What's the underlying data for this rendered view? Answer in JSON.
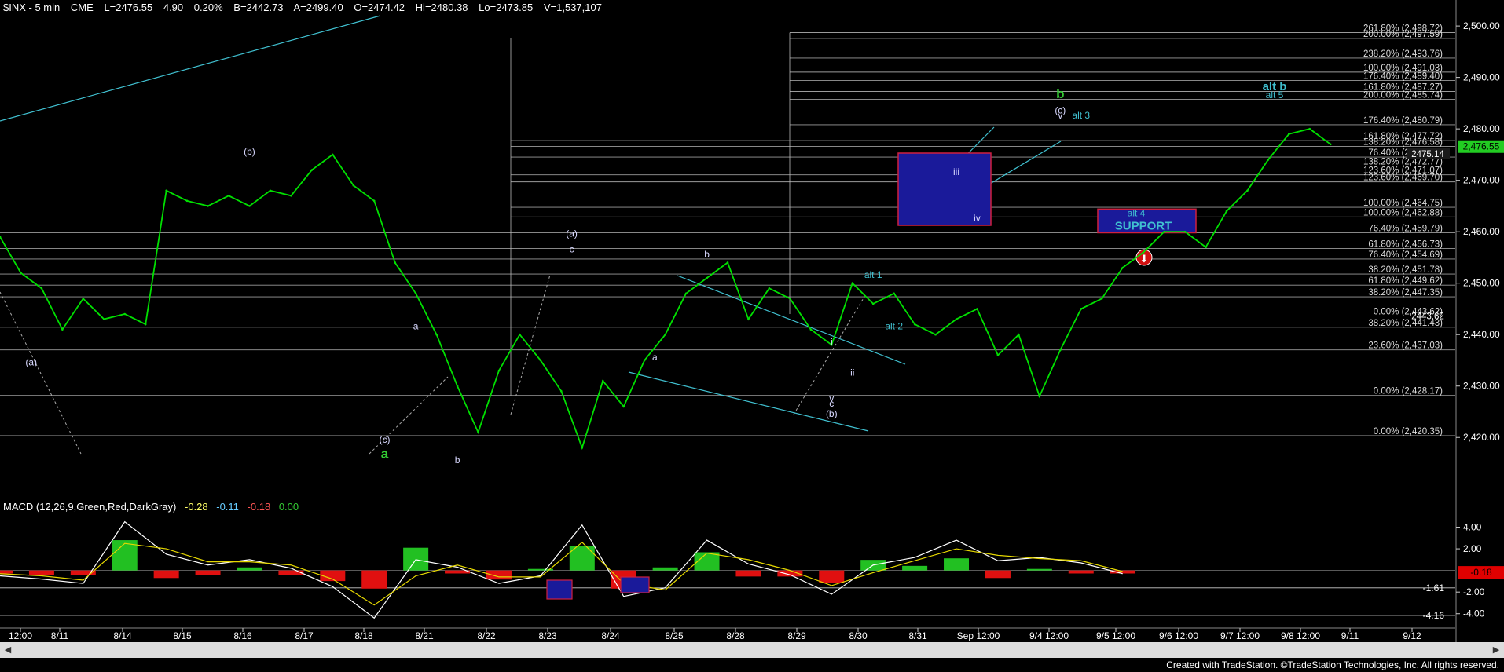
{
  "header": {
    "symbol": "$INX - 5 min",
    "exchange": "CME",
    "last": "L=2476.55",
    "change": "4.90",
    "change_pct": "0.20%",
    "bid": "B=2442.73",
    "ask": "A=2499.40",
    "open": "O=2474.42",
    "high": "Hi=2480.38",
    "low": "Lo=2473.85",
    "volume": "V=1,537,107"
  },
  "macd_header": {
    "name": "MACD (12,26,9,Green,Red,DarkGray)",
    "v1": "-0.28",
    "v2": "-0.11",
    "v3": "-0.18",
    "v4": "0.00"
  },
  "footer": "Created with TradeStation. ©TradeStation Technologies, Inc. All rights reserved.",
  "colors": {
    "background": "#000000",
    "price": "#00e000",
    "fib_line": "#cfcfcf",
    "channel": "#40c0d0",
    "label_wave": "#d8d8ff",
    "label_green": "#33cc33",
    "support_box": "#1a1a9a",
    "support_border": "#d02040",
    "last_price_tag": "#22cc22",
    "macd_tag": "#e00000"
  },
  "chart_data": {
    "type": "line",
    "title": "$INX - 5 min",
    "ylim": [
      2415,
      2502
    ],
    "price_ticks": [
      "2,500.00",
      "2,490.00",
      "2,480.00",
      "2,470.00",
      "2,460.00",
      "2,450.00",
      "2,440.00",
      "2,430.00",
      "2,420.00"
    ],
    "price_tick_values": [
      2500,
      2490,
      2480,
      2470,
      2460,
      2450,
      2440,
      2430,
      2420
    ],
    "x_labels": [
      "12:00",
      "8/11",
      "8/14",
      "8/15",
      "8/16",
      "8/17",
      "8/18",
      "8/21",
      "8/22",
      "8/23",
      "8/24",
      "8/25",
      "8/28",
      "8/29",
      "8/30",
      "8/31",
      "Sep 12:00",
      "9/4 12:00",
      "9/5 12:00",
      "9/6 12:00",
      "9/7 12:00",
      "9/8 12:00",
      "9/11",
      "9/12"
    ],
    "price_series": {
      "name": "$INX",
      "x": [
        0,
        2,
        4,
        6,
        8,
        10,
        12,
        14,
        16,
        18,
        20,
        22,
        24,
        26,
        28,
        30,
        32,
        34,
        36,
        38,
        40,
        42,
        44,
        46,
        48,
        50,
        52,
        54,
        56,
        58,
        60,
        62,
        64,
        66,
        68,
        70,
        72,
        74,
        76,
        78,
        80,
        82,
        84,
        86,
        88,
        90,
        92,
        94,
        96,
        98,
        100,
        102,
        104,
        106,
        108,
        110,
        112,
        114,
        116,
        118,
        120,
        122,
        124,
        126,
        128
      ],
      "y": [
        2459,
        2452,
        2449,
        2441,
        2447,
        2443,
        2444,
        2442,
        2468,
        2466,
        2465,
        2467,
        2465,
        2468,
        2467,
        2472,
        2475,
        2469,
        2466,
        2454,
        2448,
        2440,
        2430,
        2421,
        2433,
        2440,
        2435,
        2429,
        2418,
        2431,
        2426,
        2435,
        2440,
        2448,
        2451,
        2454,
        2443,
        2449,
        2447,
        2441,
        2438,
        2450,
        2446,
        2448,
        2442,
        2440,
        2443,
        2445,
        2436,
        2440,
        2428,
        2437,
        2445,
        2447,
        2453,
        2456,
        2460,
        2460,
        2457,
        2464,
        2468,
        2474,
        2479,
        2480,
        2477
      ]
    },
    "fib_levels": [
      {
        "label": "261.80% (2,498.72)",
        "value": 2498.72
      },
      {
        "label": "200.00% (2,497.59)",
        "value": 2497.59
      },
      {
        "label": "238.20% (2,493.76)",
        "value": 2493.76
      },
      {
        "label": "100.00% (2,491.03)",
        "value": 2491.03
      },
      {
        "label": "176.40% (2,489.40)",
        "value": 2489.4
      },
      {
        "label": "161.80% (2,487.27)",
        "value": 2487.27
      },
      {
        "label": "200.00% (2,485.74)",
        "value": 2485.74
      },
      {
        "label": "176.40% (2,480.79)",
        "value": 2480.79
      },
      {
        "label": "161.80% (2,477.72)",
        "value": 2477.72
      },
      {
        "label": "138.20% (2,476.58)",
        "value": 2476.58
      },
      {
        "label": "76.40% (2,474.51)",
        "value": 2474.51
      },
      {
        "label": "138.20% (2,472.77)",
        "value": 2472.77
      },
      {
        "label": "123.60% (2,471.07)",
        "value": 2471.07
      },
      {
        "label": "123.60% (2,469.70)",
        "value": 2469.7
      },
      {
        "label": "100.00% (2,464.75)",
        "value": 2464.75
      },
      {
        "label": "100.00% (2,462.88)",
        "value": 2462.88
      },
      {
        "label": "76.40% (2,459.79)",
        "value": 2459.79
      },
      {
        "label": "61.80% (2,456.73)",
        "value": 2456.73
      },
      {
        "label": "76.40% (2,454.69)",
        "value": 2454.69
      },
      {
        "label": "38.20% (2,451.78)",
        "value": 2451.78
      },
      {
        "label": "61.80% (2,449.62)",
        "value": 2449.62
      },
      {
        "label": "38.20% (2,447.35)",
        "value": 2447.35
      },
      {
        "label": "0.00% (2,443.62)",
        "value": 2443.62
      },
      {
        "label": "38.20% (2,441.43)",
        "value": 2441.43
      },
      {
        "label": "23.60% (2,437.03)",
        "value": 2437.03
      },
      {
        "label": "0.00% (2,428.17)",
        "value": 2428.17
      },
      {
        "label": "0.00% (2,420.35)",
        "value": 2420.35
      }
    ],
    "last_price_tag": "2,476.55",
    "inner_price_tag": "2475.14",
    "inner_price_tag2": "2443.62",
    "wave_labels": [
      {
        "text": "(b)",
        "x": 24,
        "y": 2475,
        "color": "wave"
      },
      {
        "text": "(a)",
        "x": 3,
        "y": 2434,
        "color": "wave"
      },
      {
        "text": "(c)",
        "x": 37,
        "y": 2419,
        "color": "wave"
      },
      {
        "text": "a",
        "x": 37,
        "y": 2416,
        "color": "green"
      },
      {
        "text": "a",
        "x": 40,
        "y": 2441,
        "color": "wave"
      },
      {
        "text": "b",
        "x": 44,
        "y": 2415,
        "color": "wave"
      },
      {
        "text": "(a)",
        "x": 55,
        "y": 2459,
        "color": "wave"
      },
      {
        "text": "c",
        "x": 55,
        "y": 2456,
        "color": "wave"
      },
      {
        "text": "b",
        "x": 68,
        "y": 2455,
        "color": "wave"
      },
      {
        "text": "a",
        "x": 63,
        "y": 2435,
        "color": "wave"
      },
      {
        "text": "v",
        "x": 80,
        "y": 2427,
        "color": "wave"
      },
      {
        "text": "c",
        "x": 80,
        "y": 2426,
        "color": "wave"
      },
      {
        "text": "(b)",
        "x": 80,
        "y": 2424,
        "color": "wave"
      },
      {
        "text": "i",
        "x": 80,
        "y": 2438,
        "color": "wave"
      },
      {
        "text": "ii",
        "x": 82,
        "y": 2432,
        "color": "wave"
      },
      {
        "text": "alt 1",
        "x": 84,
        "y": 2451,
        "color": "channel"
      },
      {
        "text": "alt 2",
        "x": 86,
        "y": 2441,
        "color": "channel"
      },
      {
        "text": "iii",
        "x": 92,
        "y": 2471,
        "color": "wave"
      },
      {
        "text": "iv",
        "x": 94,
        "y": 2462,
        "color": "wave"
      },
      {
        "text": "v",
        "x": 102,
        "y": 2482,
        "color": "wave"
      },
      {
        "text": "(c)",
        "x": 102,
        "y": 2483,
        "color": "wave"
      },
      {
        "text": "b",
        "x": 102,
        "y": 2486,
        "color": "green"
      },
      {
        "text": "alt 3",
        "x": 104,
        "y": 2482,
        "color": "channel"
      }
    ],
    "right_labels": [
      {
        "text": "alt b",
        "value": 2487.5
      },
      {
        "text": "alt 5",
        "value": 2486.0
      }
    ],
    "support": {
      "label": "SUPPORT",
      "alt_label": "alt 4",
      "top": 2464.4,
      "bottom": 2459.8
    },
    "macd": {
      "ylim": [
        -4.6,
        5.2
      ],
      "ticks": [
        "4.00",
        "2.00",
        "-2.00",
        "-4.00"
      ],
      "tick_values": [
        4,
        2,
        -2,
        -4
      ],
      "levels": [
        {
          "label": "-1.61",
          "value": -1.61
        },
        {
          "label": "-4.16",
          "value": -4.16
        }
      ],
      "current": "-0.18",
      "x": [
        0,
        4,
        8,
        12,
        16,
        20,
        24,
        28,
        32,
        36,
        40,
        44,
        48,
        52,
        56,
        60,
        64,
        68,
        72,
        76,
        80,
        84,
        88,
        92,
        96,
        100,
        104,
        108
      ],
      "macd": [
        -0.5,
        -0.8,
        -1.2,
        4.5,
        1.5,
        0.5,
        1,
        0.2,
        -1.5,
        -4.4,
        1,
        0.3,
        -1.2,
        -0.5,
        4.2,
        -2.4,
        -1.6,
        2.8,
        0.6,
        -0.4,
        -2.2,
        0.5,
        1.2,
        2.8,
        0.9,
        1.2,
        0.7,
        -0.3
      ],
      "signal": [
        -0.3,
        -0.5,
        -0.9,
        2.5,
        2,
        0.8,
        0.8,
        0.5,
        -0.8,
        -3.2,
        -0.5,
        0.5,
        -0.6,
        -0.6,
        2.6,
        -1.2,
        -1.8,
        1.6,
        1,
        0,
        -1.4,
        -0.2,
        0.9,
        2,
        1.4,
        1.1,
        0.9,
        -0.1
      ]
    }
  }
}
